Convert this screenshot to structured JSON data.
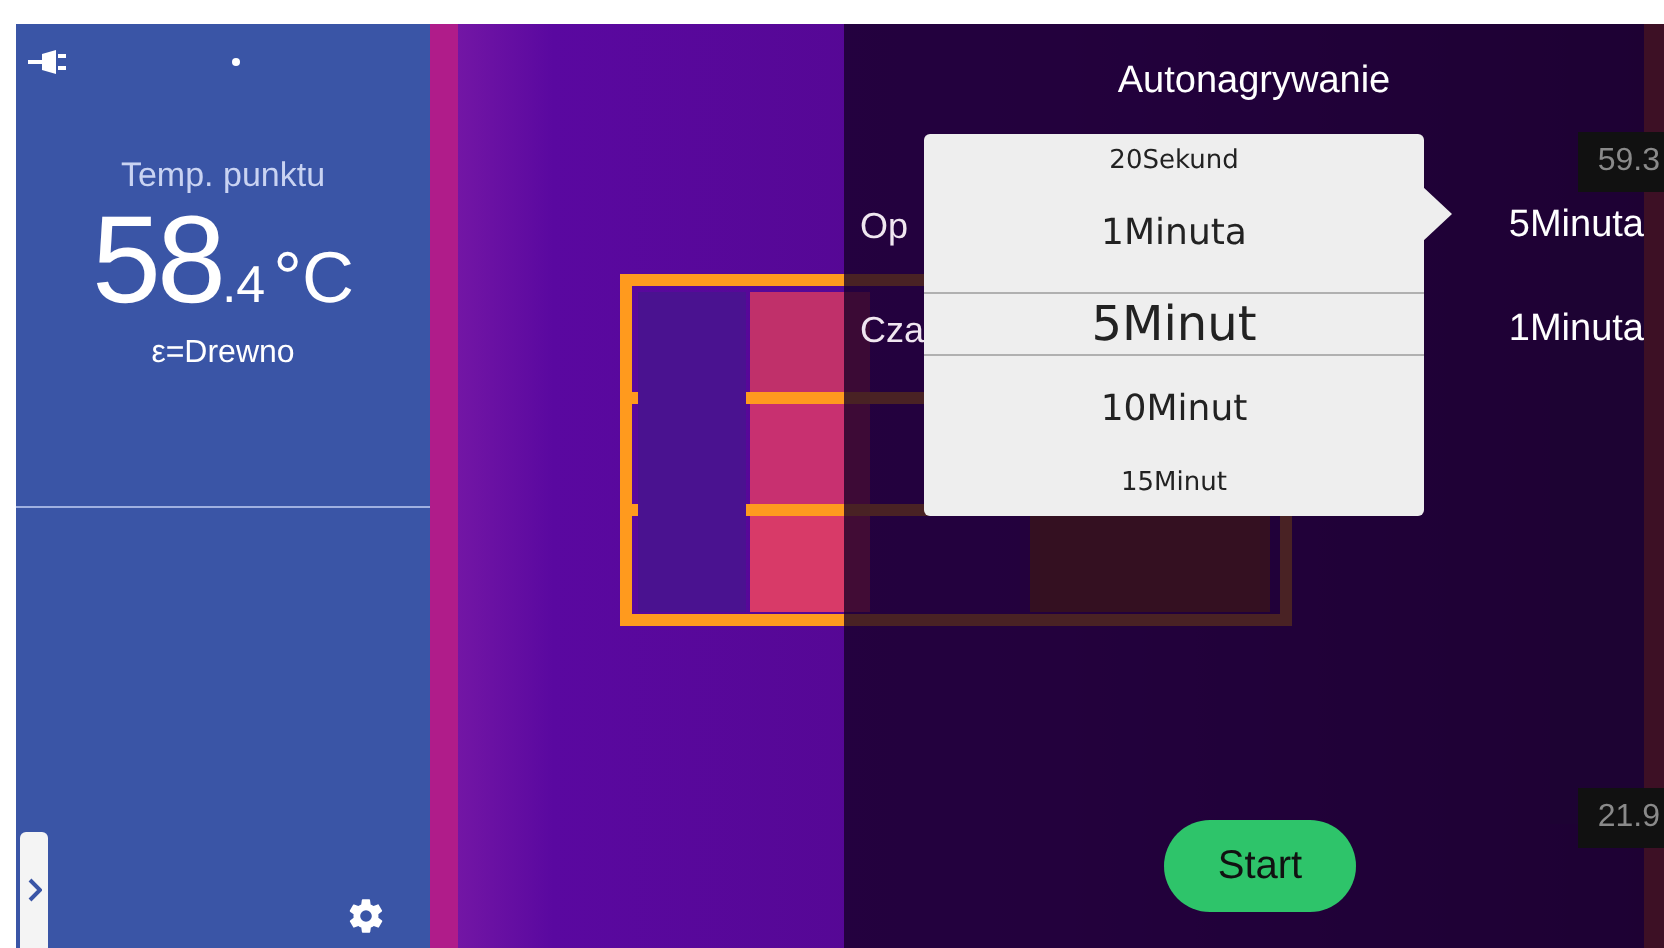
{
  "sidebar": {
    "temp_label": "Temp. punktu",
    "temp_integer": "58",
    "temp_decimal": ".4",
    "temp_unit": "°C",
    "emissivity": "ε=Drewno"
  },
  "dialog": {
    "title": "Autonagrywanie",
    "settings": [
      {
        "label": "Op",
        "value": "5Minuta"
      },
      {
        "label": "Cza",
        "value": "1Minuta"
      }
    ],
    "start_button": "Start"
  },
  "picker": {
    "options": [
      {
        "label": "20Sekund",
        "selected": false
      },
      {
        "label": "1Minuta",
        "selected": false
      },
      {
        "label": "5Minut",
        "selected": true
      },
      {
        "label": "10Minut",
        "selected": false
      },
      {
        "label": "15Minut",
        "selected": false
      }
    ]
  },
  "scale": {
    "max": "59.3",
    "min": "21.9"
  }
}
